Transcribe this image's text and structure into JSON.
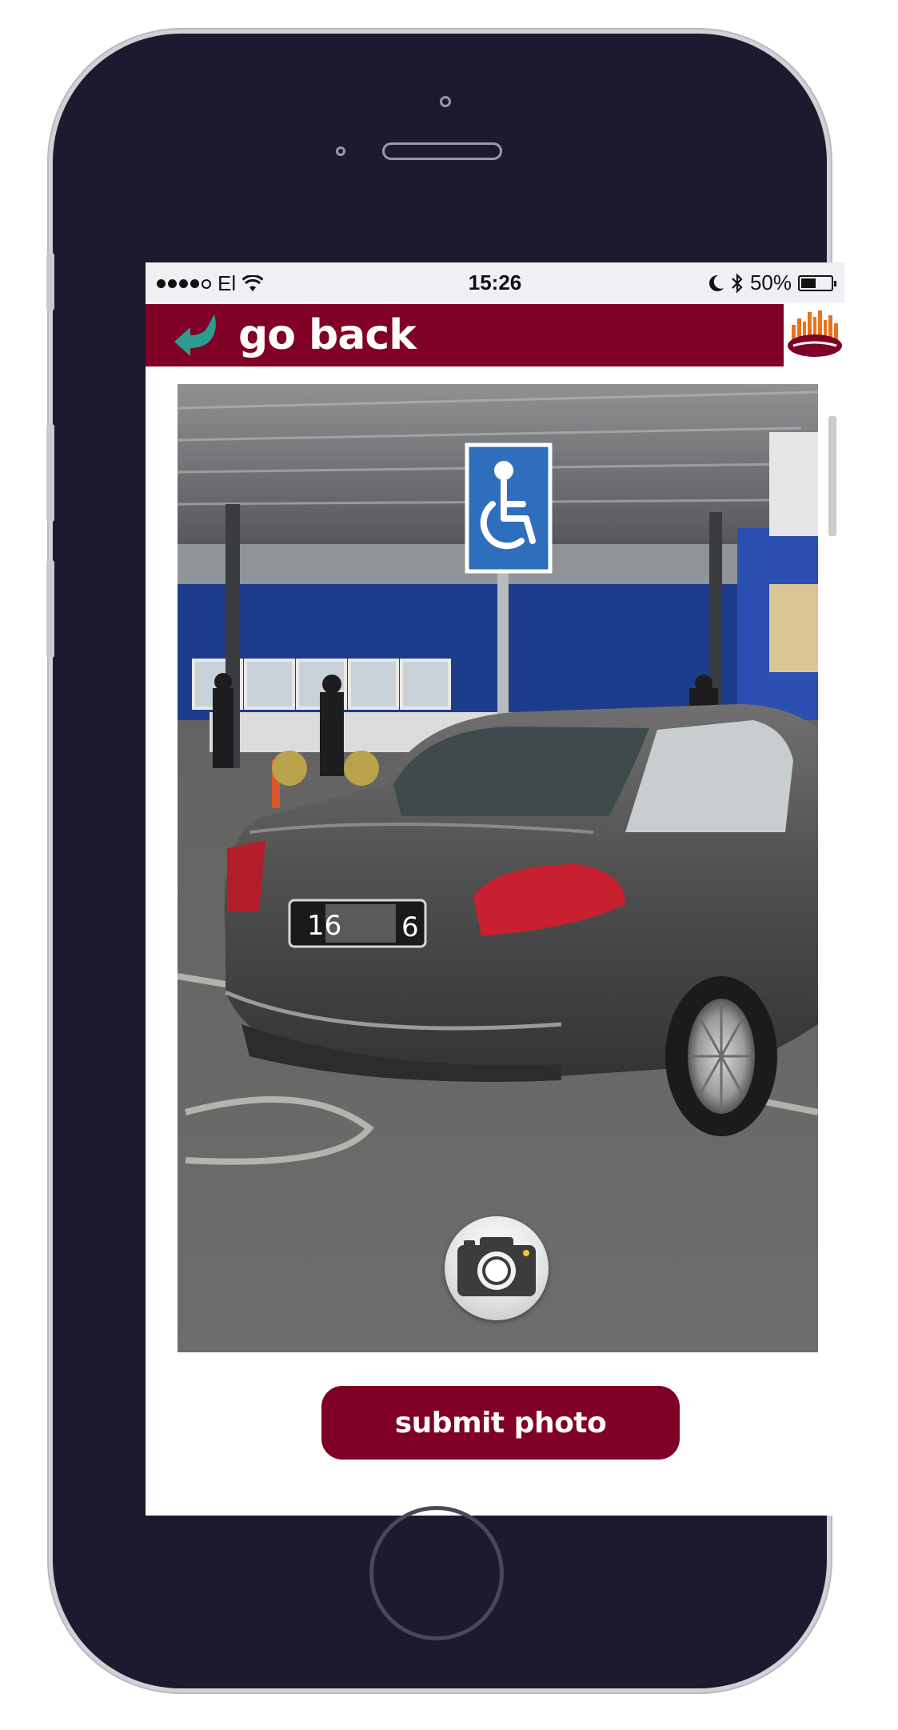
{
  "status_bar": {
    "carrier": "El",
    "time": "15:26",
    "battery_percent": "50%",
    "battery_level": 0.5,
    "icons": [
      "signal-dots-icon",
      "wifi-icon",
      "moon-icon",
      "bluetooth-icon",
      "battery-icon"
    ]
  },
  "header": {
    "back_label": "go back",
    "back_icon": "back-arrow-icon",
    "logo": "app-logo"
  },
  "photo": {
    "plate_left": "16",
    "plate_right": "6",
    "camera_icon": "camera-icon"
  },
  "actions": {
    "submit_label": "submit photo"
  },
  "colors": {
    "brand": "#800026",
    "accent": "#2a9d8f",
    "phone_body": "#1c1a2e",
    "status_bar_bg": "#efeff4"
  }
}
